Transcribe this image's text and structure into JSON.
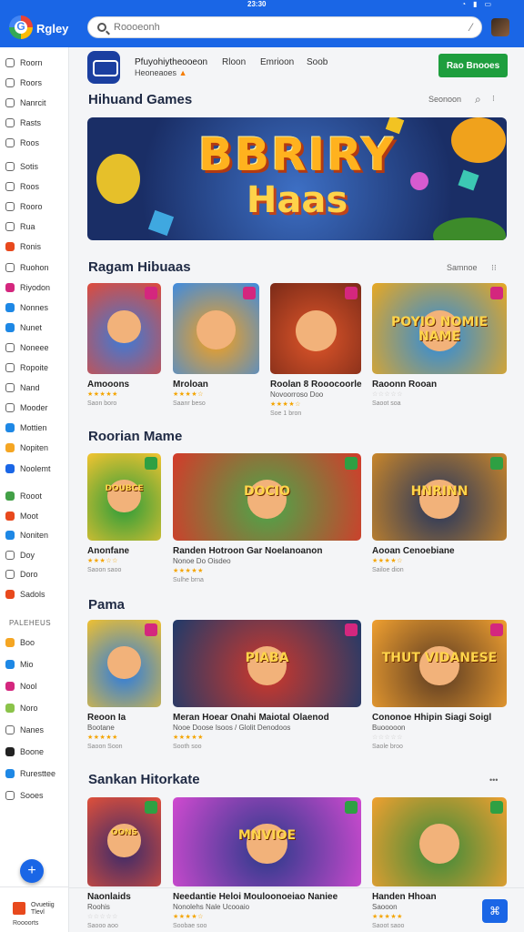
{
  "status": {
    "time": "23:30"
  },
  "header": {
    "logo_letter": "G",
    "title": "Rgley",
    "search_placeholder": "Roooeonh"
  },
  "sidebar": {
    "items": [
      {
        "label": "Roorn",
        "color": "#666"
      },
      {
        "label": "Roors",
        "color": "#666"
      },
      {
        "label": "Nanrcit",
        "color": "#666"
      },
      {
        "label": "Rasts",
        "color": "#666"
      },
      {
        "label": "Roos",
        "color": "#666"
      },
      {
        "label": "Sotis",
        "color": "#666"
      },
      {
        "label": "Roos",
        "color": "#666"
      },
      {
        "label": "Rooro",
        "color": "#666"
      },
      {
        "label": "Rua",
        "color": "#666"
      },
      {
        "label": "Ronis",
        "color": "#e8491d"
      },
      {
        "label": "Ruohon",
        "color": "#666"
      },
      {
        "label": "Riyodon",
        "color": "#d4277e"
      },
      {
        "label": "Nonnes",
        "color": "#1e88e5"
      },
      {
        "label": "Nunet",
        "color": "#1e88e5"
      },
      {
        "label": "Noneee",
        "color": "#666"
      },
      {
        "label": "Ropoite",
        "color": "#666"
      },
      {
        "label": "Nand",
        "color": "#666"
      },
      {
        "label": "Mooder",
        "color": "#666"
      },
      {
        "label": "Mottien",
        "color": "#1e88e5"
      },
      {
        "label": "Nopiten",
        "color": "#f5a623"
      },
      {
        "label": "Noolemt",
        "color": "#1a66e6"
      },
      {
        "label": "Rooot",
        "color": "#43a047"
      },
      {
        "label": "Moot",
        "color": "#e8491d"
      },
      {
        "label": "Noniten",
        "color": "#1e88e5"
      },
      {
        "label": "Doy",
        "color": "#666"
      },
      {
        "label": "Doro",
        "color": "#666"
      },
      {
        "label": "Sadols",
        "color": "#e8491d"
      }
    ],
    "section_label": "PALEHEUS",
    "items2": [
      {
        "label": "Boo",
        "color": "#f5a623"
      },
      {
        "label": "Mio",
        "color": "#1e88e5"
      },
      {
        "label": "Nool",
        "color": "#d4277e"
      },
      {
        "label": "Noro",
        "color": "#8bc34a"
      },
      {
        "label": "Nanes",
        "color": "#666"
      },
      {
        "label": "Boone",
        "color": "#222"
      },
      {
        "label": "Ruresttee",
        "color": "#1e88e5"
      },
      {
        "label": "Sooes",
        "color": "#666"
      }
    ],
    "footer": {
      "title": "Ovuetiig Tlevl",
      "sub": "Roooorts"
    }
  },
  "developer": {
    "name": "Pfuyohiytheooeon",
    "sub": "Heoneaoes",
    "links": [
      "Rloon",
      "Emrioon",
      "Soob"
    ],
    "install": "Rao Bnooes"
  },
  "sections": [
    {
      "title": "Hihuand Games",
      "meta": "Seonoon"
    },
    {
      "title": "Ragam Hibuaas",
      "meta": "Samnoe"
    },
    {
      "title": "Roorian Mame",
      "meta": ""
    },
    {
      "title": "Pama",
      "meta": ""
    },
    {
      "title": "Sankan Hitorkate",
      "meta": ""
    }
  ],
  "hero": {
    "line1": "BBRIRY",
    "line2": "Haas"
  },
  "rows": [
    [
      {
        "title": "Amooons",
        "sub": "",
        "foot": "Saon boro",
        "rating": 5,
        "banner": ""
      },
      {
        "title": "Mroloan",
        "sub": "",
        "foot": "Saanr beso",
        "rating": 4,
        "banner": ""
      },
      {
        "title": "Roolan 8 Rooocoorle",
        "sub": "Novoorroso Doo",
        "foot": "Soe 1 bron",
        "rating": 4,
        "banner": ""
      },
      {
        "title": "Raoonn Rooan",
        "sub": "",
        "foot": "Saoot soa",
        "rating": 0,
        "banner": "POYIO NOMIE NAME"
      }
    ],
    [
      {
        "title": "Anonfane",
        "sub": "",
        "foot": "Saoon saoo",
        "rating": 3,
        "banner": "DOUBCE"
      },
      {
        "title": "Randen Hotroon Gar Noelanoanon",
        "sub": "Nonoe Do Oisdeo",
        "foot": "Sulhe brna",
        "rating": 5,
        "banner": "DOCIO"
      },
      {
        "title": "Aooan Cenoebiane",
        "sub": "",
        "foot": "Sailoe dion",
        "rating": 4,
        "banner": "HNRINN"
      }
    ],
    [
      {
        "title": "Reoon Ia",
        "sub": "Bootane",
        "foot": "Saoon Soon",
        "rating": 5,
        "banner": ""
      },
      {
        "title": "Meran Hoear Onahi Maiotal Olaenod",
        "sub": "Nooe Doose Isoos / Glolit Denodoos",
        "foot": "Sooth soo",
        "rating": 5,
        "banner": "PIABA"
      },
      {
        "title": "Cononoe Hhipin Siagi Soigl",
        "sub": "Buooooon",
        "foot": "Saole broo",
        "rating": 0,
        "banner": "THUT VIDANESE"
      }
    ],
    [
      {
        "title": "Naonlaids",
        "sub": "Roohis",
        "foot": "Saooo aoo",
        "rating": 0,
        "banner": "OONS"
      },
      {
        "title": "Needantie Heloi Mouloonoeiao Naniee",
        "sub": "Nonolehs Nale Ucooaio",
        "foot": "Soobae soo",
        "rating": 4,
        "banner": "MNVIOE"
      },
      {
        "title": "Handen Hhoan",
        "sub": "Saooon",
        "foot": "Saoot saoo",
        "rating": 5,
        "banner": ""
      }
    ]
  ],
  "colors": {
    "accent": "#1a66e6",
    "install": "#1e9e3e",
    "star": "#f4a400"
  }
}
